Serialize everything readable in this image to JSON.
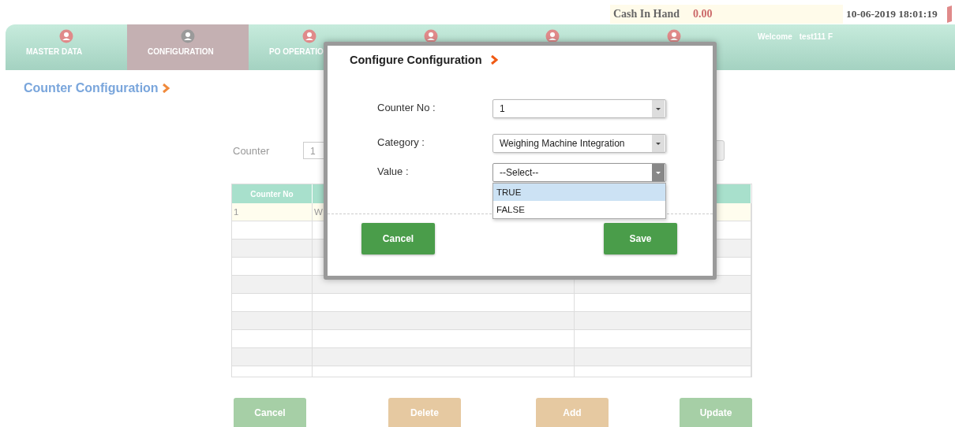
{
  "top_bar": {
    "cash_label": "Cash In Hand",
    "cash_value": "0.00",
    "datetime": "10-06-2019 18:01:19"
  },
  "nav": {
    "tabs": [
      {
        "label": "MASTER DATA",
        "selected": false
      },
      {
        "label": "CONFIGURATION",
        "selected": true
      },
      {
        "label": "PO OPERATIO",
        "selected": false
      },
      {
        "selected": false
      },
      {
        "selected": false
      },
      {
        "selected": false
      }
    ],
    "welcome": "Welcome",
    "user": "test111 F"
  },
  "page": {
    "title": "Counter Configuration",
    "counter_label": "Counter",
    "counter_value": "1",
    "table": {
      "columns": [
        "Counter No"
      ],
      "rows": [
        {
          "counter_no": "1",
          "column_2": "W"
        }
      ]
    },
    "buttons": [
      {
        "label": "Cancel",
        "kind": "green"
      },
      {
        "label": "Delete",
        "kind": "tan"
      },
      {
        "label": "Add",
        "kind": "tan"
      },
      {
        "label": "Update",
        "kind": "green"
      }
    ]
  },
  "dialog": {
    "title": "Configure Configuration",
    "fields": [
      {
        "label": "Counter No :",
        "value": "1"
      },
      {
        "label": "Category :",
        "value": "Weighing Machine Integration"
      },
      {
        "label": "Value :",
        "value": "--Select--",
        "expanded": true
      }
    ],
    "options": [
      {
        "label": "TRUE",
        "selected": true
      },
      {
        "label": "FALSE",
        "selected": false
      }
    ],
    "buttons": [
      "Cancel",
      "Save"
    ]
  }
}
